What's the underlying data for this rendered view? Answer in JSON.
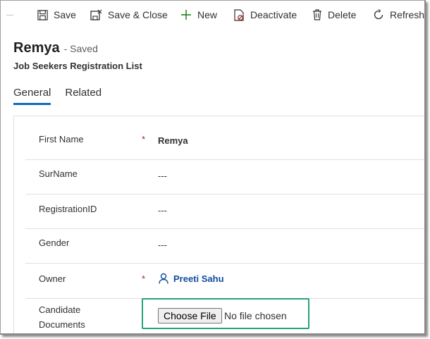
{
  "toolbar": {
    "save_label": "Save",
    "save_close_label": "Save & Close",
    "new_label": "New",
    "deactivate_label": "Deactivate",
    "delete_label": "Delete",
    "refresh_label": "Refresh"
  },
  "header": {
    "title": "Remya",
    "status": "- Saved",
    "entity": "Job Seekers Registration List"
  },
  "tabs": [
    {
      "label": "General",
      "active": true
    },
    {
      "label": "Related",
      "active": false
    }
  ],
  "form": {
    "fields": [
      {
        "label": "First Name",
        "required": true,
        "value": "Remya"
      },
      {
        "label": "SurName",
        "required": false,
        "value": "---"
      },
      {
        "label": "RegistrationID",
        "required": false,
        "value": "---"
      },
      {
        "label": "Gender",
        "required": false,
        "value": "---"
      },
      {
        "label": "Owner",
        "required": true,
        "value": "Preeti Sahu"
      },
      {
        "label_line1": "Candidate",
        "label_line2": "Documents",
        "required": false
      }
    ],
    "required_marker": "*",
    "file_button_label": "Choose File",
    "file_status": "No file chosen"
  },
  "colors": {
    "accent": "#0f6cbd",
    "required": "#a4262c",
    "highlight_border": "#28a17d",
    "link": "#0f4c9c",
    "new_icon": "#107c10"
  },
  "icons": [
    "save-icon",
    "save-close-icon",
    "plus-icon",
    "deactivate-icon",
    "trash-icon",
    "refresh-icon",
    "person-icon"
  ]
}
